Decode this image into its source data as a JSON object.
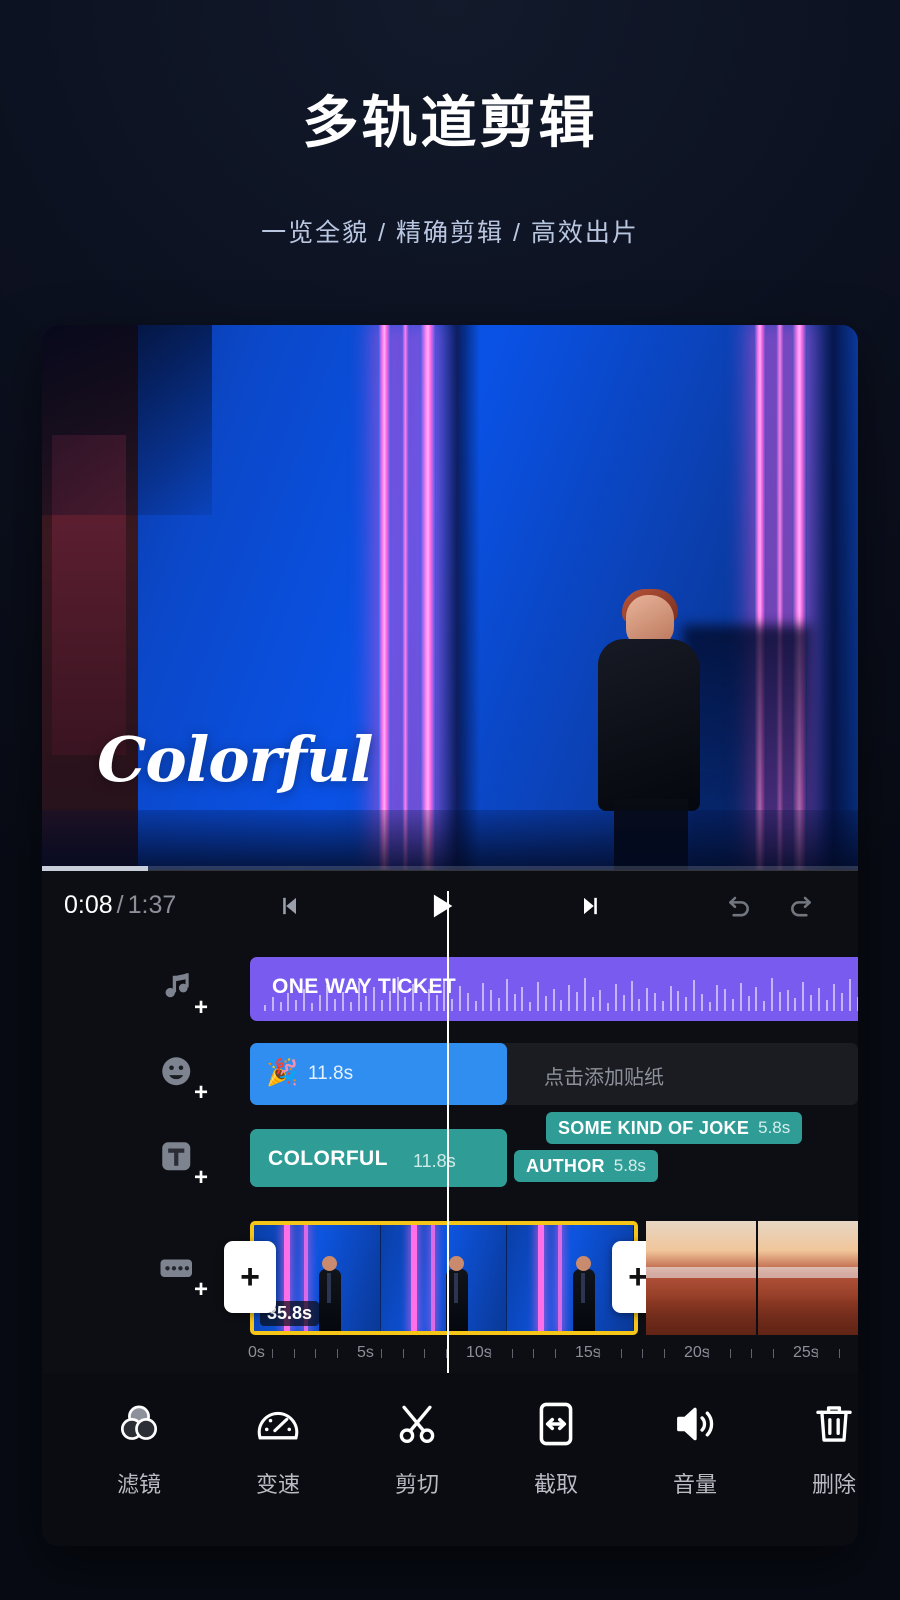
{
  "hero": {
    "title": "多轨道剪辑",
    "subtitle": "一览全貌 / 精确剪辑 / 高效出片"
  },
  "preview": {
    "overlay_text": "Colorful",
    "progress_percent": 13
  },
  "transport": {
    "current_time": "0:08",
    "separator": "/",
    "total_time": "1:37",
    "prev_label": "prev-frame",
    "play_label": "play",
    "next_label": "next-frame",
    "undo_label": "undo",
    "redo_label": "redo"
  },
  "timeline": {
    "audio_track": {
      "icon": "music-note-add-icon",
      "clip_title": "ONE WAY TICKET"
    },
    "sticker_track": {
      "icon": "sticker-face-add-icon",
      "clip_emoji": "🎉",
      "clip_duration": "11.8s",
      "empty_hint": "点击添加贴纸"
    },
    "text_track": {
      "icon": "text-add-icon",
      "main_clip_label": "COLORFUL",
      "main_clip_duration": "11.8s",
      "chips": [
        {
          "label": "SOME KIND OF JOKE",
          "duration": "5.8s"
        },
        {
          "label": "AUTHOR",
          "duration": "5.8s"
        }
      ]
    },
    "video_track": {
      "icon": "film-strip-add-icon",
      "selected_clip_duration": "35.8s",
      "left_handle": "+",
      "right_handle": "+"
    },
    "ruler_labels": [
      "0s",
      "5s",
      "10s",
      "15s",
      "20s",
      "25s"
    ]
  },
  "toolbar": {
    "items": [
      {
        "icon": "filter-icon",
        "label": "滤镜"
      },
      {
        "icon": "speed-icon",
        "label": "变速"
      },
      {
        "icon": "scissors-icon",
        "label": "剪切"
      },
      {
        "icon": "crop-icon",
        "label": "截取"
      },
      {
        "icon": "volume-icon",
        "label": "音量"
      },
      {
        "icon": "trash-icon",
        "label": "删除"
      }
    ]
  },
  "colors": {
    "accent_audio": "#7a5bf0",
    "accent_sticker": "#2f8ef0",
    "accent_text": "#2f9d96",
    "selection": "#f5c518",
    "playhead": "#ffffff"
  }
}
